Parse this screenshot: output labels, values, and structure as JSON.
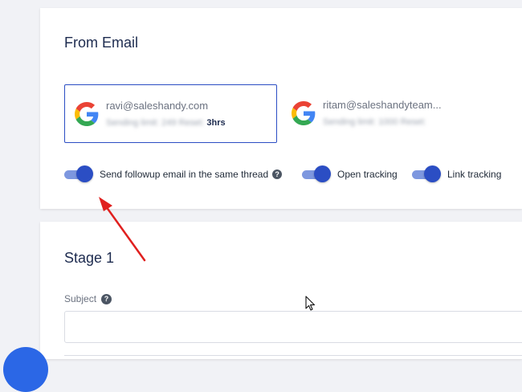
{
  "from_email": {
    "title": "From Email",
    "accounts": [
      {
        "email": "ravi@saleshandy.com",
        "limit_label": "Sending limit:",
        "limit_value": "249",
        "reset_label": "Reset:",
        "reset_value": "3hrs",
        "selected": true
      },
      {
        "email": "ritam@saleshandyteam...",
        "limit_label": "Sending limit:",
        "limit_value": "1000",
        "reset_label": "Reset:",
        "reset_value": "",
        "selected": false
      }
    ],
    "toggles": [
      {
        "label": "Send followup email in the same thread",
        "on": true,
        "help": "?"
      },
      {
        "label": "Open tracking",
        "on": true
      },
      {
        "label": "Link tracking",
        "on": true
      }
    ]
  },
  "stage": {
    "title": "Stage 1",
    "subject_label": "Subject",
    "subject_help": "?",
    "subject_value": "",
    "subject_placeholder": ""
  },
  "colors": {
    "accent": "#2b4ec4",
    "toggle_track": "#7d97df",
    "annotation_arrow": "#e0201f",
    "fab": "#2b67e6"
  },
  "icons": {
    "google": "google-icon",
    "help": "question-circle-icon",
    "cursor": "mouse-cursor-icon"
  }
}
